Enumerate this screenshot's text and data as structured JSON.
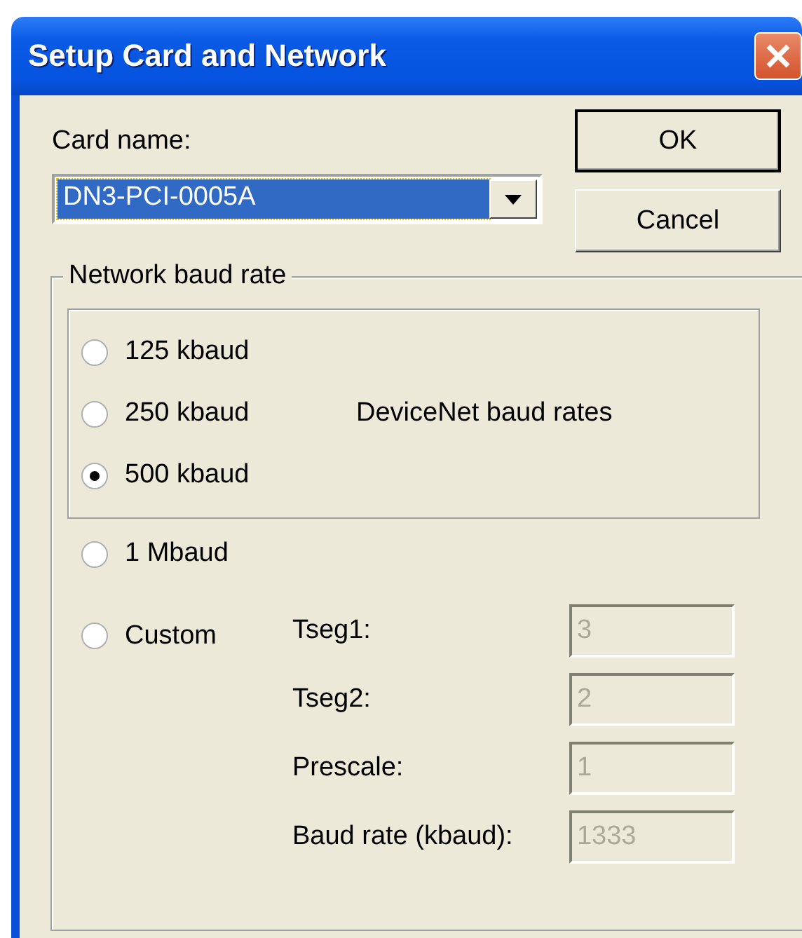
{
  "window": {
    "title": "Setup Card and Network"
  },
  "card_name": {
    "label": "Card name:",
    "value": "DN3-PCI-0005A",
    "highlighted": true
  },
  "buttons": [
    {
      "label": "OK",
      "default": true
    },
    {
      "label": "Cancel",
      "default": false
    }
  ],
  "baud_group": {
    "title": "Network baud rate",
    "devicenet_label": "DeviceNet baud rates",
    "options": [
      {
        "label": "125 kbaud",
        "kind": "devicenet",
        "selected": false
      },
      {
        "label": "250 kbaud",
        "kind": "devicenet",
        "selected": false
      },
      {
        "label": "500 kbaud",
        "kind": "devicenet",
        "selected": true
      },
      {
        "label": "1 Mbaud",
        "kind": "other",
        "selected": false
      },
      {
        "label": "Custom",
        "kind": "custom",
        "selected": false
      }
    ],
    "custom_fields": [
      {
        "label": "Tseg1:",
        "value": "3",
        "disabled": true
      },
      {
        "label": "Tseg2:",
        "value": "2",
        "disabled": true
      },
      {
        "label": "Prescale:",
        "value": "1",
        "disabled": true
      },
      {
        "label": "Baud rate (kbaud):",
        "value": "1333",
        "disabled": true
      }
    ]
  }
}
